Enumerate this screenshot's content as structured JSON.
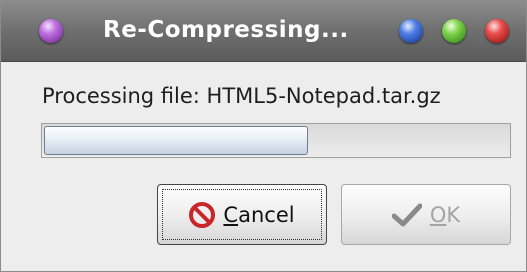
{
  "window": {
    "title": "Re-Compressing...",
    "controls": [
      "menu",
      "minimize",
      "maximize",
      "close"
    ]
  },
  "dialog": {
    "message": "Processing file: HTML5-Notepad.tar.gz",
    "progress_fraction": 0.57
  },
  "buttons": {
    "cancel_label": "Cancel",
    "cancel_icon": "no-entry-icon",
    "ok_label": "OK",
    "ok_icon": "checkmark-icon",
    "ok_enabled": false
  },
  "colors": {
    "cancel_icon": "#c8262a",
    "ok_icon": "#8a8a8a"
  }
}
